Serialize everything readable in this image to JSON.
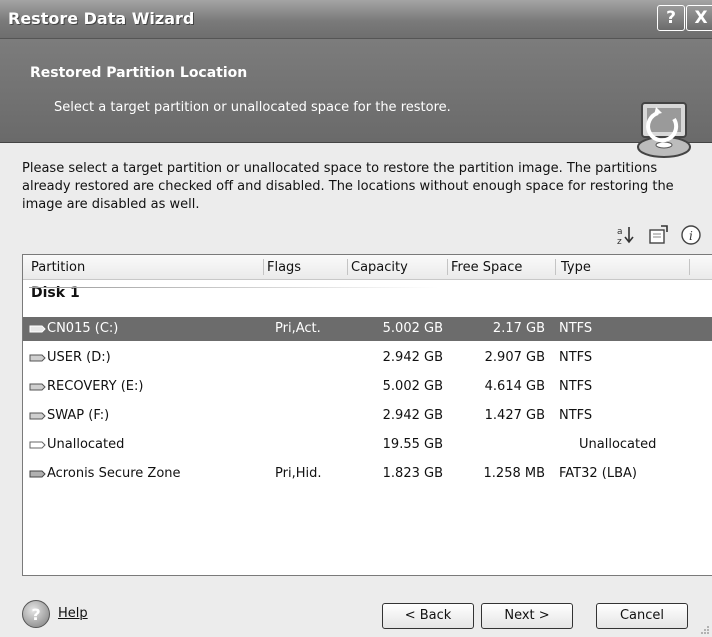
{
  "window": {
    "title": "Restore Data Wizard",
    "help_button": "?",
    "close_button": "X"
  },
  "header": {
    "title": "Restored Partition Location",
    "subtitle": "Select a target partition or unallocated space for the restore."
  },
  "description": "Please select a target partition or unallocated space to restore the partition image. The partitions already restored are checked off and disabled. The locations without enough space for restoring the image are disabled as well.",
  "toolbar_icons": [
    "sort-icon",
    "properties-icon",
    "info-icon"
  ],
  "table": {
    "columns": [
      "Partition",
      "Flags",
      "Capacity",
      "Free Space",
      "Type"
    ],
    "group": "Disk 1",
    "rows": [
      {
        "partition": "CN015 (C:)",
        "flags": "Pri,Act.",
        "capacity": "5.002 GB",
        "free": "2.17 GB",
        "type": "NTFS",
        "selected": true
      },
      {
        "partition": "USER (D:)",
        "flags": "",
        "capacity": "2.942 GB",
        "free": "2.907 GB",
        "type": "NTFS"
      },
      {
        "partition": "RECOVERY (E:)",
        "flags": "",
        "capacity": "5.002 GB",
        "free": "4.614 GB",
        "type": "NTFS"
      },
      {
        "partition": "SWAP (F:)",
        "flags": "",
        "capacity": "2.942 GB",
        "free": "1.427 GB",
        "type": "NTFS"
      },
      {
        "partition": "Unallocated",
        "flags": "",
        "capacity": "19.55 GB",
        "free": "",
        "type": "Unallocated"
      },
      {
        "partition": "Acronis Secure Zone",
        "flags": "Pri,Hid.",
        "capacity": "1.823 GB",
        "free": "1.258 MB",
        "type": "FAT32 (LBA)"
      }
    ]
  },
  "footer": {
    "help_label": "Help",
    "back_label": "< Back",
    "next_label": "Next >",
    "cancel_label": "Cancel"
  }
}
